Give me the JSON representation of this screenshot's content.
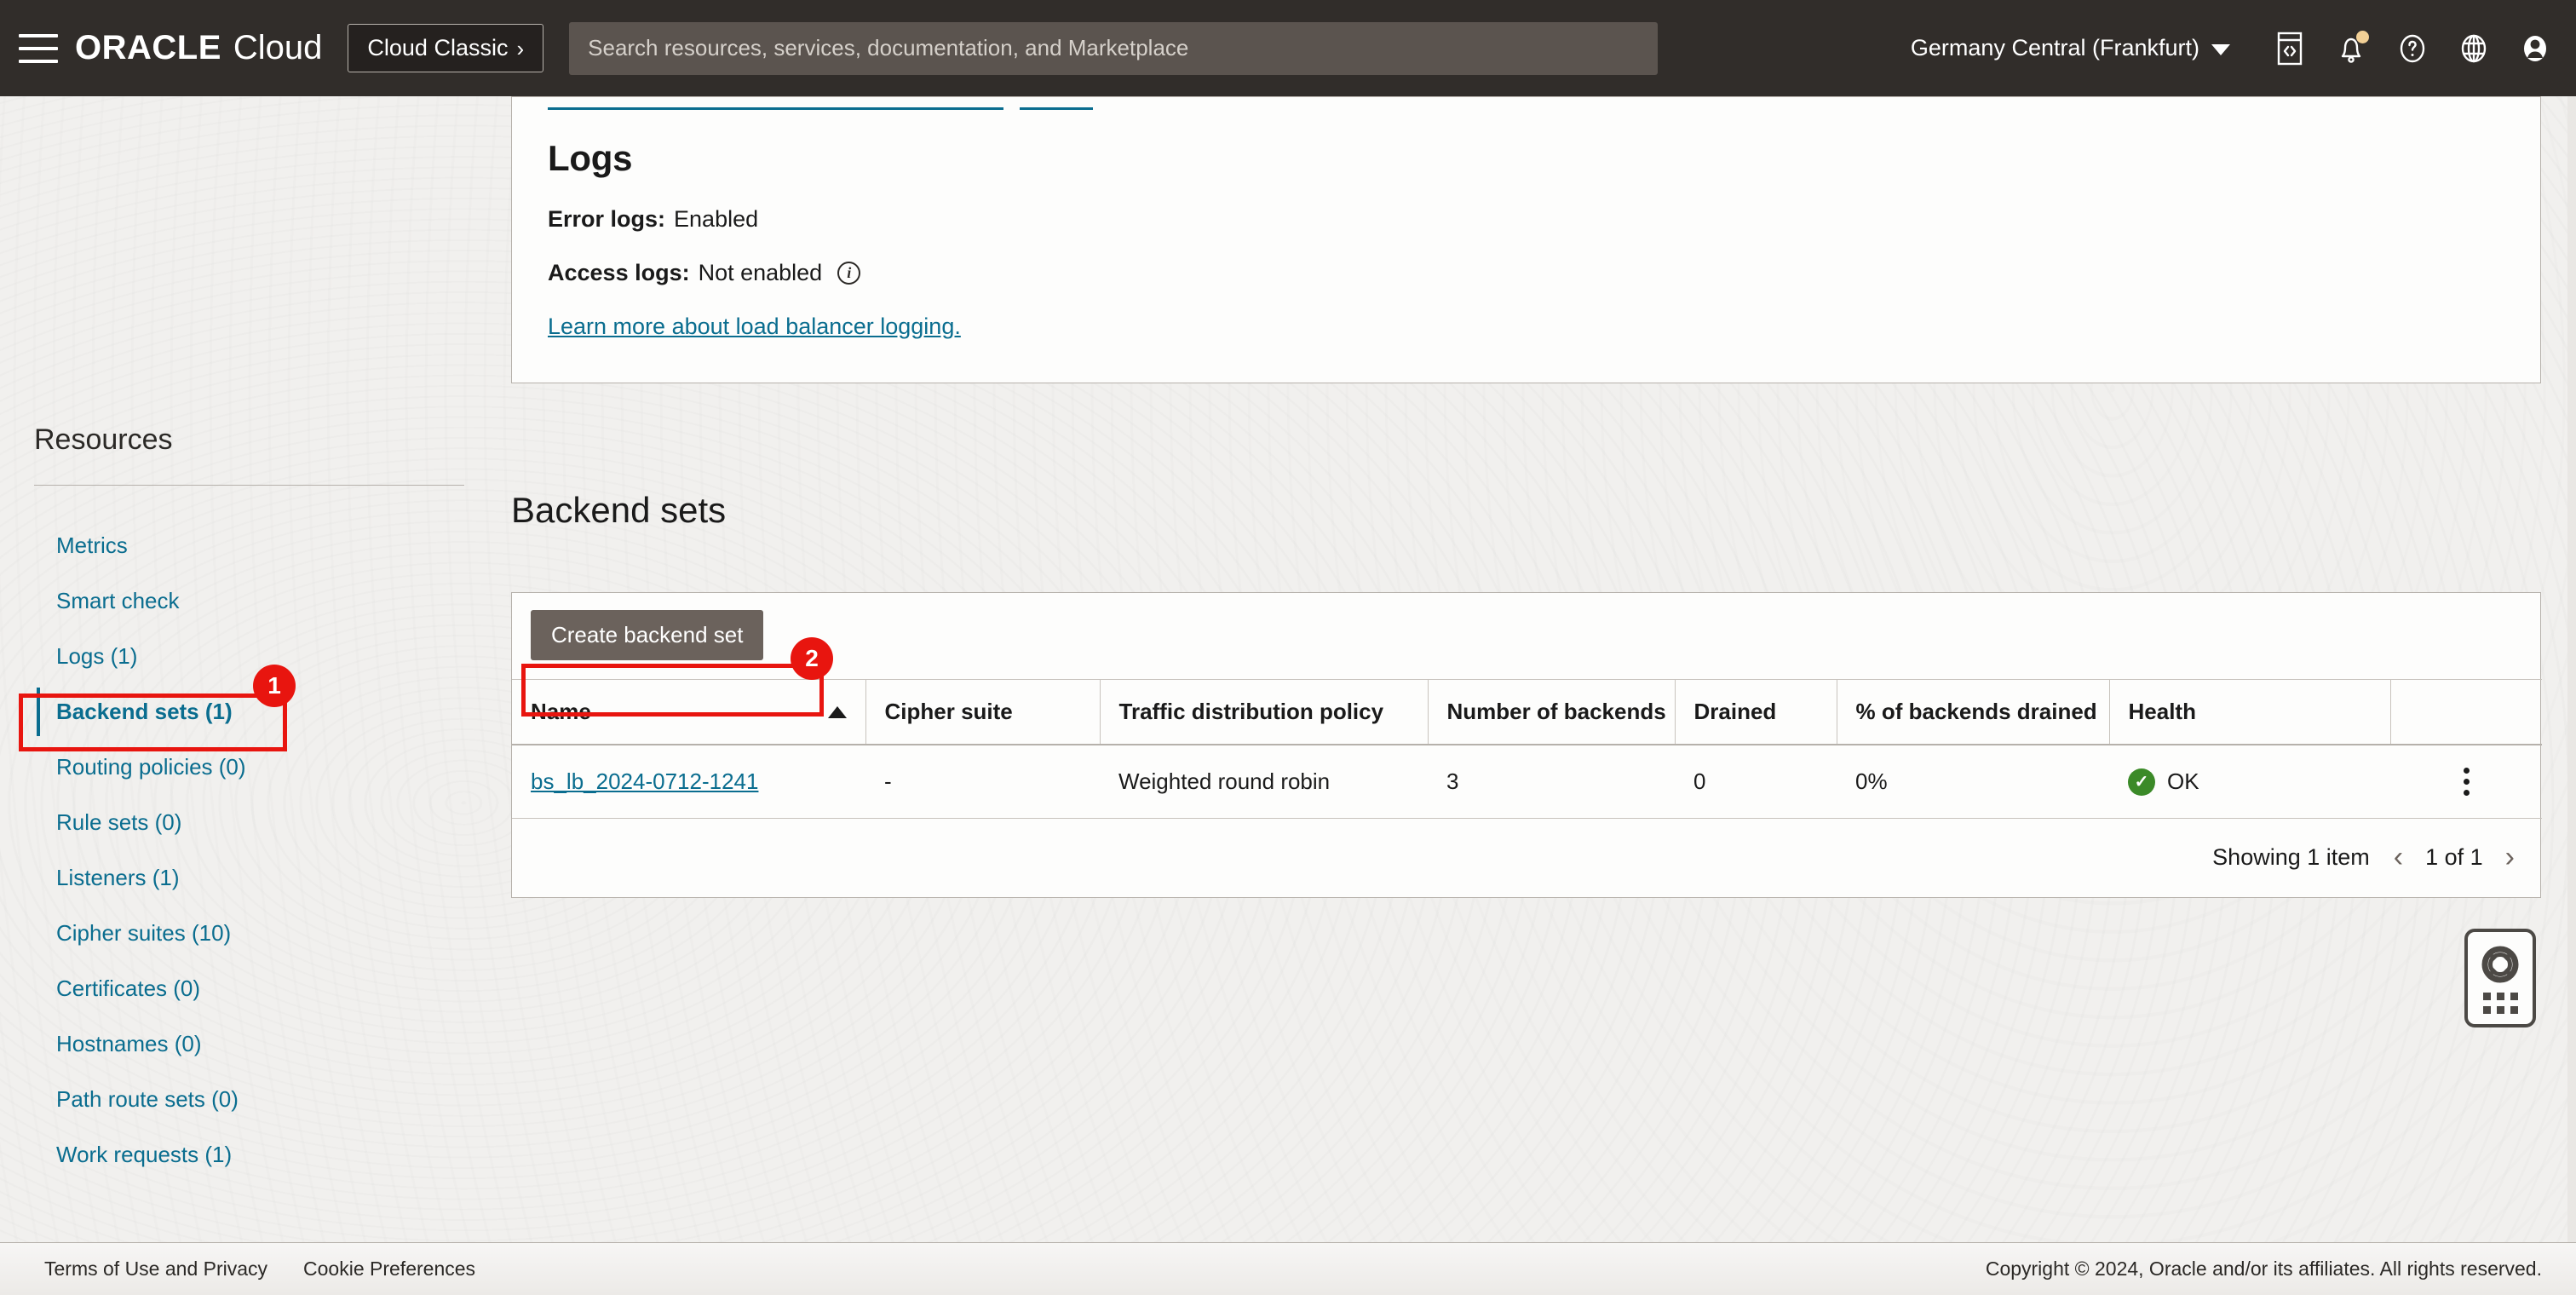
{
  "header": {
    "menu_icon": "hamburger-icon",
    "brand_oracle": "ORACLE",
    "brand_cloud": "Cloud",
    "classic_button": "Cloud Classic",
    "classic_chevron": "›",
    "search_placeholder": "Search resources, services, documentation, and Marketplace",
    "search_value": "",
    "region": "Germany Central (Frankfurt)",
    "icons": [
      "code-editor-icon",
      "notifications-bell-icon",
      "help-question-icon",
      "globe-language-icon",
      "user-avatar-icon"
    ]
  },
  "sidebar": {
    "title": "Resources",
    "items": [
      {
        "label": "Metrics",
        "active": false
      },
      {
        "label": "Smart check",
        "active": false
      },
      {
        "label": "Logs (1)",
        "active": false
      },
      {
        "label": "Backend sets (1)",
        "active": true
      },
      {
        "label": "Routing policies (0)",
        "active": false
      },
      {
        "label": "Rule sets (0)",
        "active": false
      },
      {
        "label": "Listeners (1)",
        "active": false
      },
      {
        "label": "Cipher suites (10)",
        "active": false
      },
      {
        "label": "Certificates (0)",
        "active": false
      },
      {
        "label": "Hostnames (0)",
        "active": false
      },
      {
        "label": "Path route sets (0)",
        "active": false
      },
      {
        "label": "Work requests (1)",
        "active": false
      }
    ]
  },
  "logs_card": {
    "heading": "Logs",
    "error_logs_label": "Error logs:",
    "error_logs_value": "Enabled",
    "access_logs_label": "Access logs:",
    "access_logs_value": "Not enabled",
    "info_icon": "info-icon",
    "learn_more_link": "Learn more about load balancer logging."
  },
  "backend_sets": {
    "title": "Backend sets",
    "create_button": "Create backend set",
    "columns": [
      "Name",
      "Cipher suite",
      "Traffic distribution policy",
      "Number of backends",
      "Drained",
      "% of backends drained",
      "Health"
    ],
    "sort_column": "Name",
    "sort_direction": "ascending",
    "rows": [
      {
        "name": "bs_lb_2024-0712-1241",
        "cipher_suite": "-",
        "traffic_policy": "Weighted round robin",
        "number_of_backends": "3",
        "drained": "0",
        "percent_drained": "0%",
        "health": "OK",
        "health_state": "ok",
        "menu_icon": "kebab-menu-icon"
      }
    ],
    "footer": {
      "showing": "Showing 1 item",
      "prev_icon": "‹",
      "page_label": "1 of 1",
      "next_icon": "›"
    }
  },
  "annotations": [
    {
      "id": "1",
      "target": "sidebar-backend-sets"
    },
    {
      "id": "2",
      "target": "table-row-name-link"
    }
  ],
  "help_widget": {
    "icon": "lifesaver-help-icon",
    "drag_handle": "drag-dots-handle"
  },
  "footer": {
    "terms": "Terms of Use and Privacy",
    "cookies": "Cookie Preferences",
    "copyright": "Copyright © 2024, Oracle and/or its affiliates. All rights reserved."
  },
  "colors": {
    "header_bg": "#312d2a",
    "link_teal": "#0a6d8f",
    "annotation_red": "#e8150f",
    "health_green": "#3b8a28",
    "button_grey": "#6b625c"
  }
}
